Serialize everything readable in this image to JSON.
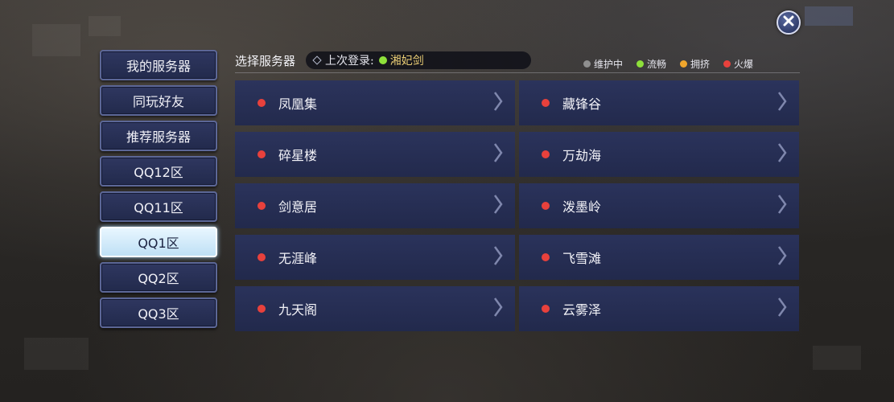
{
  "colors": {
    "maintenance": "#8f8f8f",
    "smooth": "#8ee03a",
    "crowded": "#f0a62c",
    "hot": "#e8413c",
    "last_login_name": "#e9cc74"
  },
  "close_button": {
    "icon": "close-icon"
  },
  "sidebar": {
    "items": [
      {
        "label": "我的服务器",
        "active": false
      },
      {
        "label": "同玩好友",
        "active": false
      },
      {
        "label": "推荐服务器",
        "active": false
      },
      {
        "label": "QQ12区",
        "active": false
      },
      {
        "label": "QQ11区",
        "active": false
      },
      {
        "label": "QQ1区",
        "active": true
      },
      {
        "label": "QQ2区",
        "active": false
      },
      {
        "label": "QQ3区",
        "active": false
      }
    ]
  },
  "header": {
    "title": "选择服务器",
    "last_login_label": "上次登录:",
    "last_login_server": "湘妃剑",
    "last_login_status": "smooth"
  },
  "legend": [
    {
      "label": "维护中",
      "status": "maintenance"
    },
    {
      "label": "流畅",
      "status": "smooth"
    },
    {
      "label": "拥挤",
      "status": "crowded"
    },
    {
      "label": "火爆",
      "status": "hot"
    }
  ],
  "servers": [
    {
      "name": "凤凰集",
      "status": "hot"
    },
    {
      "name": "藏锋谷",
      "status": "hot"
    },
    {
      "name": "碎星楼",
      "status": "hot"
    },
    {
      "name": "万劫海",
      "status": "hot"
    },
    {
      "name": "剑意居",
      "status": "hot"
    },
    {
      "name": "泼墨岭",
      "status": "hot"
    },
    {
      "name": "无涯峰",
      "status": "hot"
    },
    {
      "name": "飞雪滩",
      "status": "hot"
    },
    {
      "name": "九天阁",
      "status": "hot"
    },
    {
      "name": "云雾泽",
      "status": "hot"
    }
  ]
}
